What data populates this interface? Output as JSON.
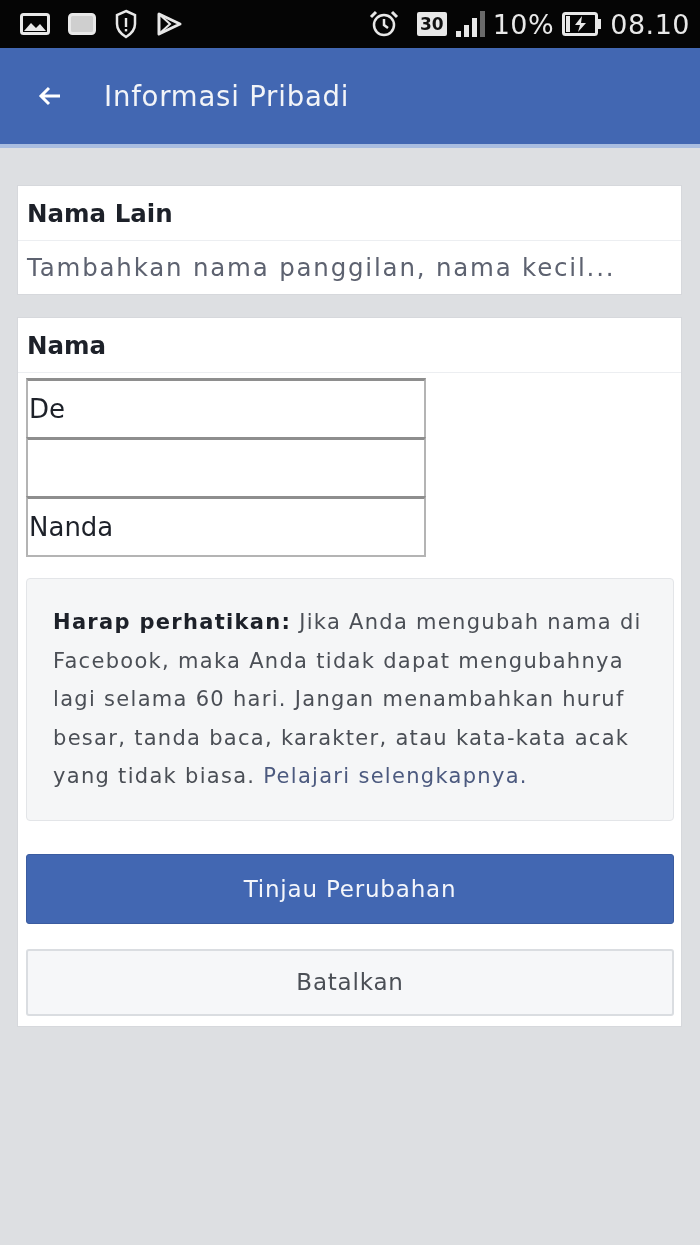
{
  "status_bar": {
    "badge": "30",
    "battery": "10%",
    "time": "08.10"
  },
  "header": {
    "title": "Informasi Pribadi"
  },
  "other_names": {
    "title": "Nama Lain",
    "prompt": "Tambahkan nama panggilan, nama kecil..."
  },
  "name": {
    "title": "Nama",
    "fields": [
      {
        "kind": "text",
        "value": "De"
      },
      {
        "kind": "blank"
      },
      {
        "kind": "text",
        "value": "Nanda"
      }
    ],
    "notice": {
      "text": "**Harap perhatikan:** Jika Anda mengubah nama di Facebook, maka Anda tidak dapat mengubahnya lagi selama 60 hari. Jangan menambahkan huruf besar, tanda baca, karakter, atau kata-kata acak yang tidak biasa.",
      "link": "Pelajari selengkapnya."
    }
  },
  "buttons": [
    {
      "label": "Tinjau Perubahan",
      "kind": "primary"
    },
    {
      "label": "Batalkan",
      "kind": "secondary"
    }
  ]
}
